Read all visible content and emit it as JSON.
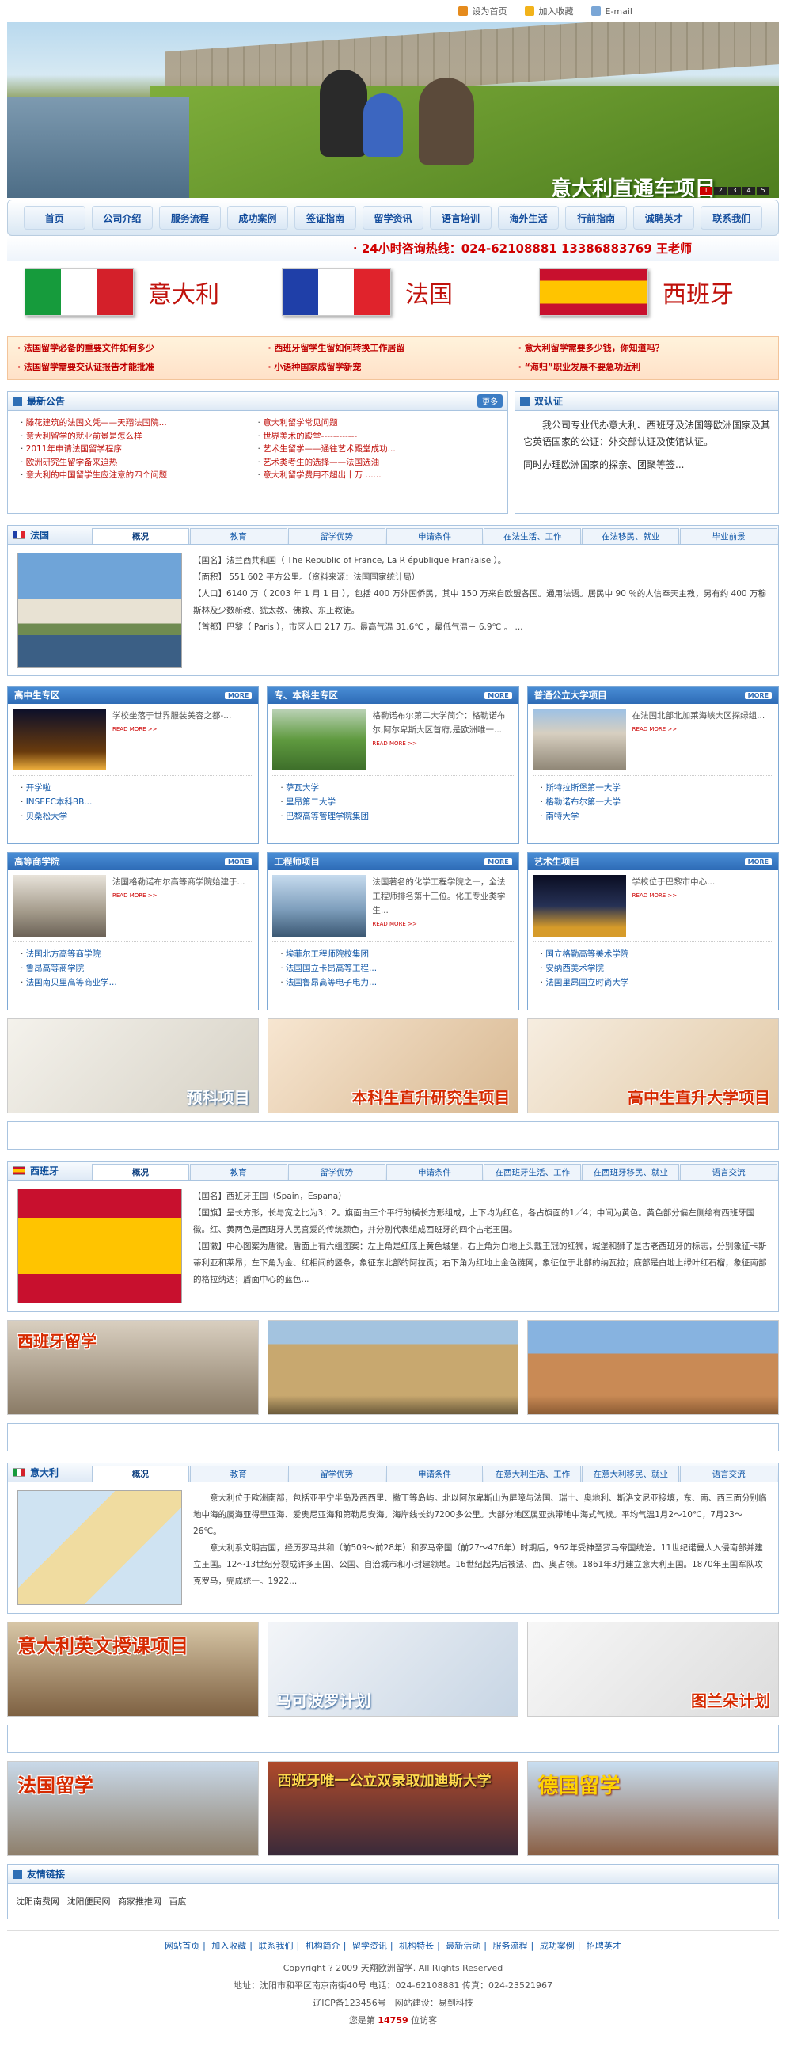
{
  "top_links": [
    "设为首页",
    "加入收藏",
    "E-mail"
  ],
  "hero": {
    "caption": "意大利直通车项目",
    "dots": [
      "1",
      "2",
      "3",
      "4",
      "5"
    ]
  },
  "nav": [
    "首页",
    "公司介绍",
    "服务流程",
    "成功案例",
    "签证指南",
    "留学资讯",
    "语言培训",
    "海外生活",
    "行前指南",
    "诚聘英才",
    "联系我们"
  ],
  "hotline": "· 24小时咨询热线：024-62108881 13386883769 王老师",
  "flags": [
    {
      "name": "意大利",
      "colors": [
        "#169b3c",
        "#ffffff",
        "#d4202a"
      ]
    },
    {
      "name": "法国",
      "colors": [
        "#1f3fa8",
        "#ffffff",
        "#e0232c"
      ]
    },
    {
      "name": "西班牙",
      "colors": [
        "#c8102e",
        "#ffc400",
        "#c8102e"
      ]
    }
  ],
  "marquee": [
    "法国留学必备的重要文件如何多少",
    "西班牙留学生留如何转换工作居留",
    "意大利留学需要多少钱，你知道吗？",
    "法国留学需要交认证报告才能批准",
    "小语种国家成留学新宠",
    "“海归”职业发展不要急功近利"
  ],
  "notice": {
    "title": "最新公告",
    "more": "更多",
    "left": [
      "滕花建筑的法国文凭——天翔法国院...",
      "意大利留学的就业前景是怎么样",
      "2011年申请法国留学程序",
      "欧洲研究生留学备来迫热",
      "意大利的中国留学生应注意的四个问题"
    ],
    "right": [
      "意大利留学常见问题",
      "世界美术的殿堂------------",
      "艺术生留学——通往艺术殿堂成功...",
      "艺术类考生的选择——法国选油",
      "意大利留学费用不超出十万 ......"
    ]
  },
  "cert": {
    "title": "双认证",
    "text": "我公司专业代办意大利、西班牙及法国等欧洲国家及其它英语国家的公证：外交部认证及使馆认证。",
    "text2": "同时办理欧洲国家的探亲、团聚等签..."
  },
  "france": {
    "name": "法国",
    "tabs": [
      "概况",
      "教育",
      "留学优势",
      "申请条件",
      "在法生活、工作",
      "在法移民、就业",
      "毕业前景"
    ],
    "lines": [
      "【国名】法兰西共和国（ The Republic of France, La R épublique Fran?aise ）。",
      "【面积】 551 602 平方公里。（资料来源：法国国家统计局）",
      "【人口】6140 万（ 2003 年 1 月 1 日 ），包括 400 万外国侨民，其中 150 万来自欧盟各国。通用法语。居民中 90 ％的人信奉天主教，另有约 400 万穆斯林及少数新教、犹太教、佛教、东正教徒。",
      "【首都】巴黎（ Paris ），市区人口 217 万。最高气温 31.6℃ ，最低气温－ 6.9℃ 。 ..."
    ]
  },
  "cards": [
    {
      "title": "高中生专区",
      "desc": "学校坐落于世界服装美容之都-...",
      "items": [
        "开学啦",
        "INSEEC本科BB...",
        "贝桑松大学"
      ]
    },
    {
      "title": "专、本科生专区",
      "desc": "格勒诺布尔第二大学简介：格勒诺布尔,阿尔卑斯大区首府,是欧洲唯一...",
      "items": [
        "萨瓦大学",
        "里昂第二大学",
        "巴黎高等管理学院集团"
      ]
    },
    {
      "title": "普通公立大学项目",
      "desc": "在法国北部北加莱海峡大区探绿组...",
      "items": [
        "斯特拉斯堡第一大学",
        "格勒诺布尔第一大学",
        "南特大学"
      ]
    },
    {
      "title": "高等商学院",
      "desc": "法国格勒诺布尔高等商学院始建于...",
      "items": [
        "法国北方高等商学院",
        "鲁昂高等商学院",
        "法国南贝里高等商业学..."
      ]
    },
    {
      "title": "工程师项目",
      "desc": "法国著名的化学工程学院之一，全法工程师排名第十三位。化工专业类学生...",
      "items": [
        "埃菲尔工程师院校集团",
        "法国国立卡昂高等工程...",
        "法国鲁昂高等电子电力..."
      ]
    },
    {
      "title": "艺术生项目",
      "desc": "学校位于巴黎市中心...",
      "items": [
        "国立格勒高等美术学院",
        "安纳西美术学院",
        "法国里昂国立时尚大学"
      ]
    }
  ],
  "read_more": "READ MORE >>",
  "more_tag": "MORE",
  "banners_fr": [
    "预科项目",
    "本科生直升研究生项目",
    "高中生直升大学项目"
  ],
  "spain": {
    "name": "西班牙",
    "tabs": [
      "概况",
      "教育",
      "留学优势",
      "申请条件",
      "在西班牙生活、工作",
      "在西班牙移民、就业",
      "语言交流"
    ],
    "lines": [
      "【国名】西班牙王国（Spain，Espana）",
      "【国旗】呈长方形，长与宽之比为3：2。旗面由三个平行的横长方形组成，上下均为红色，各占旗面的1／4；中间为黄色。黄色部分偏左侧绘有西班牙国徽。红、黄两色是西班牙人民喜爱的传统颜色，并分别代表组成西班牙的四个古老王国。",
      "【国徽】中心图案为盾徽。盾面上有六组图案：左上角是红底上黄色城堡，右上角为白地上头戴王冠的红狮，城堡和狮子是古老西班牙的标志，分别象征卡斯蒂利亚和莱昂；左下角为金、红相间的竖条，象征东北部的阿拉贡；右下角为红地上金色链网，象征位于北部的纳瓦拉；底部是白地上绿叶红石榴，象征南部的格拉纳达；盾面中心的蓝色..."
    ]
  },
  "banners_es": [
    "西班牙留学",
    "",
    ""
  ],
  "italy": {
    "name": "意大利",
    "tabs": [
      "概况",
      "教育",
      "留学优势",
      "申请条件",
      "在意大利生活、工作",
      "在意大利移民、就业",
      "语言交流"
    ],
    "lines": [
      "意大利位于欧洲南部，包括亚平宁半岛及西西里、撒丁等岛屿。北以阿尔卑斯山为屏障与法国、瑞士、奥地利、斯洛文尼亚接壤，东、南、西三面分别临地中海的属海亚得里亚海、爱奥尼亚海和第勒尼安海。海岸线长约7200多公里。大部分地区属亚热带地中海式气候。平均气温1月2～10℃，7月23～26℃。",
      "意大利系文明古国，经历罗马共和（前509～前28年）和罗马帝国（前27～476年）时期后，962年受神圣罗马帝国统治。11世纪诺曼人入侵南部并建立王国。12～13世纪分裂成许多王国、公国、自治城市和小封建领地。16世纪起先后被法、西、奥占领。1861年3月建立意大利王国。1870年王国军队攻克罗马，完成统一。1922..."
    ]
  },
  "banners_it": [
    "意大利英文授课项目",
    "马可波罗计划",
    "图兰朵计划"
  ],
  "banners_misc": [
    "法国留学",
    "西班牙唯一公立双录取加迪斯大学",
    "德国留学"
  ],
  "friends": {
    "title": "友情链接",
    "links": [
      "沈阳南费网",
      "沈阳便民网",
      "商家推推网",
      "百度"
    ]
  },
  "footer": {
    "links": [
      "网站首页",
      "加入收藏",
      "联系我们",
      "机构简介",
      "留学资讯",
      "机构特长",
      "最新活动",
      "服务流程",
      "成功案例",
      "招聘英才"
    ],
    "copyright": "Copyright ? 2009 天翔欧洲留学. All Rights Reserved",
    "address": "地址：沈阳市和平区南京南街40号 电话：024-62108881 传真：024-23521967",
    "icp": "辽ICP备123456号　网站建设：易到科技",
    "visitor_prefix": "您是第",
    "visitor_count": "14759",
    "visitor_suffix": "位访客"
  }
}
